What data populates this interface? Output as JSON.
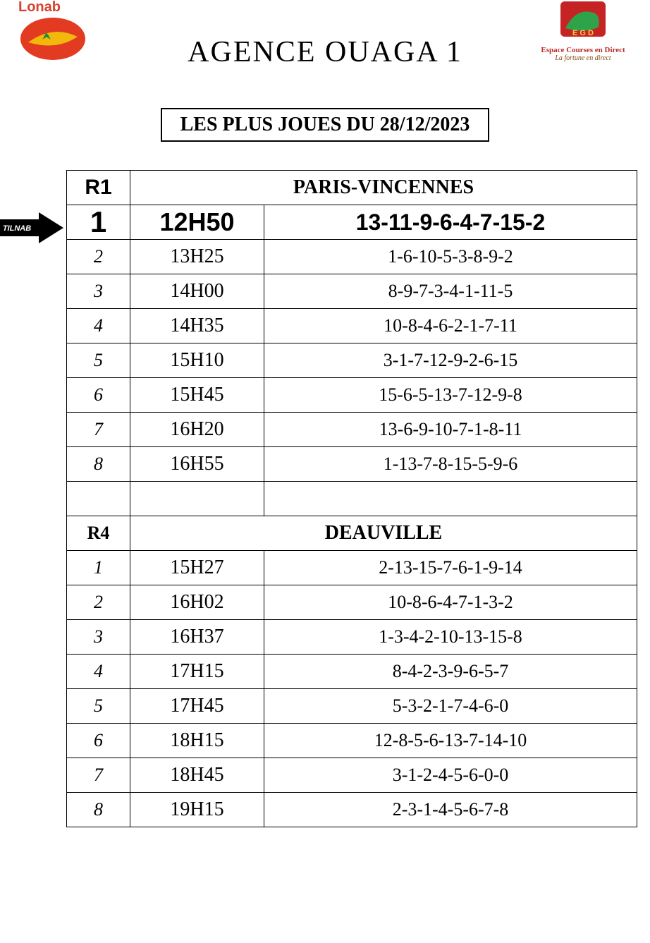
{
  "header": {
    "title": "AGENCE  OUAGA 1",
    "logo_left_text": "Lonab",
    "logo_right_name": "Espace Courses en Direct",
    "logo_right_tagline": "La fortune en direct"
  },
  "subtitle": "LES PLUS JOUES DU 28/12/2023",
  "blocks": [
    {
      "code": "R1",
      "venue": "PARIS-VINCENNES",
      "highlight_first": true,
      "rows": [
        {
          "num": "1",
          "time": "12H50",
          "picks": "13-11-9-6-4-7-15-2"
        },
        {
          "num": "2",
          "time": "13H25",
          "picks": "1-6-10-5-3-8-9-2"
        },
        {
          "num": "3",
          "time": "14H00",
          "picks": "8-9-7-3-4-1-11-5"
        },
        {
          "num": "4",
          "time": "14H35",
          "picks": "10-8-4-6-2-1-7-11"
        },
        {
          "num": "5",
          "time": "15H10",
          "picks": "3-1-7-12-9-2-6-15"
        },
        {
          "num": "6",
          "time": "15H45",
          "picks": "15-6-5-13-7-12-9-8"
        },
        {
          "num": "7",
          "time": "16H20",
          "picks": "13-6-9-10-7-1-8-11"
        },
        {
          "num": "8",
          "time": "16H55",
          "picks": "1-13-7-8-15-5-9-6"
        }
      ]
    },
    {
      "code": "R4",
      "venue": "DEAUVILLE",
      "highlight_first": false,
      "rows": [
        {
          "num": "1",
          "time": "15H27",
          "picks": "2-13-15-7-6-1-9-14"
        },
        {
          "num": "2",
          "time": "16H02",
          "picks": "10-8-6-4-7-1-3-2"
        },
        {
          "num": "3",
          "time": "16H37",
          "picks": "1-3-4-2-10-13-15-8"
        },
        {
          "num": "4",
          "time": "17H15",
          "picks": "8-4-2-3-9-6-5-7"
        },
        {
          "num": "5",
          "time": "17H45",
          "picks": "5-3-2-1-7-4-6-0"
        },
        {
          "num": "6",
          "time": "18H15",
          "picks": "12-8-5-6-13-7-14-10"
        },
        {
          "num": "7",
          "time": "18H45",
          "picks": "3-1-2-4-5-6-0-0"
        },
        {
          "num": "8",
          "time": "19H15",
          "picks": "2-3-1-4-5-6-7-8"
        }
      ]
    }
  ],
  "arrow_label": "TILNAB"
}
